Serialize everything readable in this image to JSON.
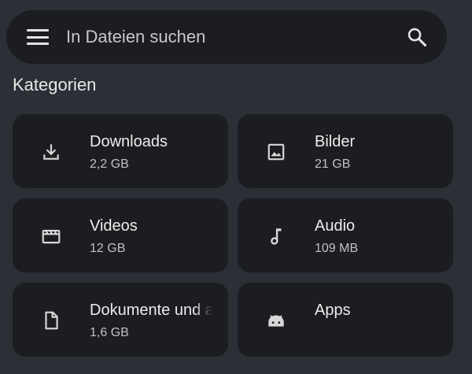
{
  "search": {
    "placeholder": "In Dateien suchen"
  },
  "categories_title": "Kategorien",
  "categories": [
    {
      "label": "Downloads",
      "size": "2,2 GB",
      "icon": "download-icon"
    },
    {
      "label": "Bilder",
      "size": "21 GB",
      "icon": "image-icon"
    },
    {
      "label": "Videos",
      "size": "12 GB",
      "icon": "video-icon"
    },
    {
      "label": "Audio",
      "size": "109 MB",
      "icon": "music-note-icon"
    },
    {
      "label": "Dokumente und andere",
      "size": "1,6 GB",
      "icon": "document-icon"
    },
    {
      "label": "Apps",
      "size": "",
      "icon": "android-icon"
    }
  ],
  "colors": {
    "background": "#2c2f36",
    "card": "#1c1d20",
    "text": "#e3e3e3",
    "secondary_text": "#bfc1c6"
  }
}
